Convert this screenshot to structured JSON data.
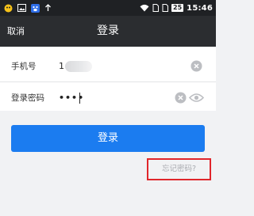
{
  "status_bar": {
    "icons": [
      "app-icon",
      "image-icon",
      "baidu-icon",
      "upload-arrow-icon",
      "wifi-icon",
      "sim-icon",
      "sim-icon",
      "battery-icon"
    ],
    "battery": "25",
    "time": "15:46"
  },
  "header": {
    "cancel_label": "取消",
    "title": "登录"
  },
  "form": {
    "phone_label": "手机号",
    "phone_value": "1",
    "password_label": "登录密码",
    "password_value": "••••"
  },
  "login_button": "登录",
  "forgot_password": "忘记密码?",
  "colors": {
    "title_bar": "#2b2d30",
    "status_bar": "#1f2124",
    "primary": "#1b7cf0",
    "highlight_box": "#e0262b",
    "background": "#f1f2f4"
  }
}
